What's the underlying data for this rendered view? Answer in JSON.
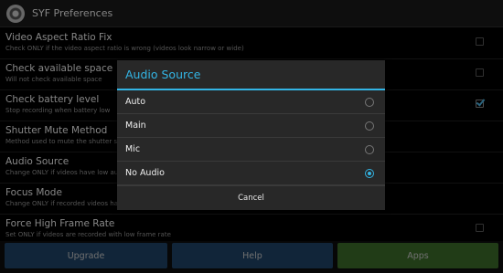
{
  "app": {
    "title": "SYF Preferences",
    "icon": "app-logo-icon"
  },
  "preferences": [
    {
      "title": "Video Aspect Ratio Fix",
      "summary": "Check ONLY if the video aspect ratio is wrong (videos look narrow or wide)",
      "checkbox": true,
      "checked": false
    },
    {
      "title": "Check available space",
      "summary": "Will not check available space",
      "checkbox": true,
      "checked": false
    },
    {
      "title": "Check battery level",
      "summary": "Stop recording when battery low",
      "checkbox": true,
      "checked": true
    },
    {
      "title": "Shutter Mute Method",
      "summary": "Method used to mute the shutter sound",
      "checkbox": false
    },
    {
      "title": "Audio Source",
      "summary": "Change ONLY if videos have low audio",
      "checkbox": false
    },
    {
      "title": "Focus Mode",
      "summary": "Change ONLY if recorded videos have bad focus",
      "checkbox": false
    },
    {
      "title": "Force High Frame Rate",
      "summary": "Set ONLY if videos are recorded with low frame rate",
      "checkbox": true,
      "checked": false
    }
  ],
  "dialog": {
    "title": "Audio Source",
    "options": [
      {
        "label": "Auto",
        "selected": false
      },
      {
        "label": "Main",
        "selected": false
      },
      {
        "label": "Mic",
        "selected": false
      },
      {
        "label": "No Audio",
        "selected": true
      }
    ],
    "cancel_label": "Cancel"
  },
  "bottom": {
    "upgrade_label": "Upgrade",
    "help_label": "Help",
    "apps_label": "Apps"
  },
  "colors": {
    "accent": "#33b5e5",
    "button_blue": "#1f4468",
    "button_green": "#3c6e2a"
  }
}
